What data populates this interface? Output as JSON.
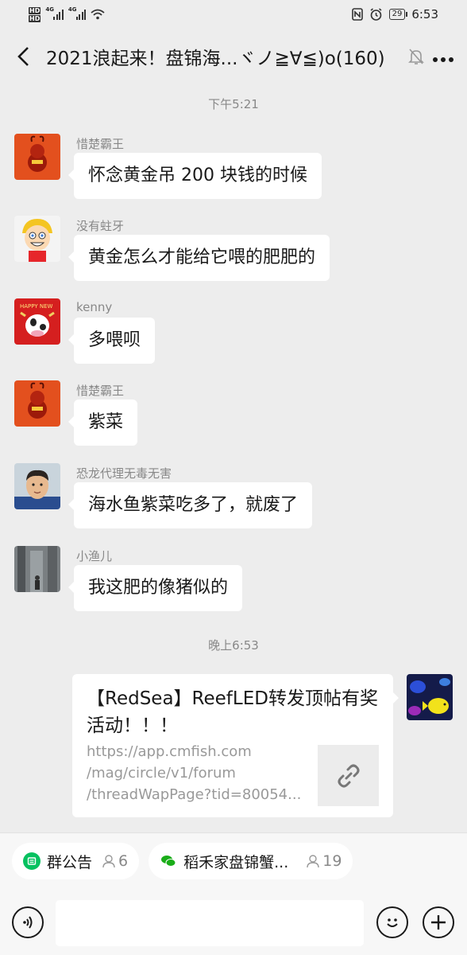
{
  "status_bar": {
    "time": "6:53",
    "battery": "29",
    "net1": "4G",
    "net2": "4G",
    "hd": "HD"
  },
  "header": {
    "title": "2021浪起来！盘锦海...ヾノ≧∀≦)o(160)"
  },
  "messages": [
    {
      "time": "下午5:21"
    },
    {
      "sender": "惜楚霸王",
      "text": "怀念黄金吊 200 块钱的时候"
    },
    {
      "sender": "没有蛀牙",
      "text": "黄金怎么才能给它喂的肥肥的"
    },
    {
      "sender": "kenny",
      "text": "多喂呗"
    },
    {
      "sender": "惜楚霸王",
      "text": "紫菜"
    },
    {
      "sender": "恐龙代理无毒无害",
      "text": "海水鱼紫菜吃多了，就废了"
    },
    {
      "sender": "小渔儿",
      "text": "我这肥的像猪似的"
    },
    {
      "time": "晚上6:53"
    }
  ],
  "link_card": {
    "title": "【RedSea】ReefLED转发顶帖有奖活动！！！",
    "url_line1": "https://app.cmfish.com",
    "url_line2": "/mag/circle/v1/forum",
    "url_line3": "/threadWapPage?tid=80054..."
  },
  "chips": [
    {
      "label": "群公告",
      "count": "6"
    },
    {
      "label": "稻禾家盘锦蟹...",
      "count": "19"
    }
  ],
  "colors": {
    "bg": "#ededed",
    "accent_green": "#07c160"
  }
}
